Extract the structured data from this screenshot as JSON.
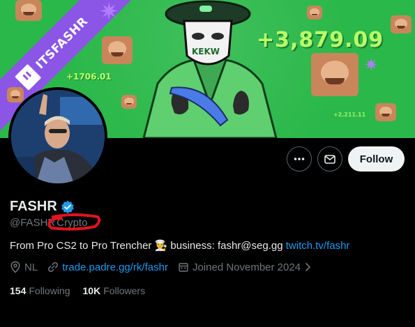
{
  "banner": {
    "ribbon_text": "ITSFASHR",
    "big_number": "+3,879.09",
    "small_number": "+1706.01",
    "tiny_number": "+2,211.11",
    "mask_text": "KEKW",
    "colors": {
      "background": "#2bb84a",
      "ribbon": "#8b55e6",
      "numbers": "#b9ff6a"
    }
  },
  "actions": {
    "more_icon": "ellipsis-icon",
    "message_icon": "envelope-icon",
    "follow_label": "Follow"
  },
  "profile": {
    "display_name": "FASHR",
    "verified_icon": "verified-badge-icon",
    "handle": "@FASHR",
    "handle_suffix": "Crypto",
    "bio_text": "From Pro CS2 to Pro Trencher 👨‍🍳 business: fashr@seg.gg ",
    "bio_link": "twitch.tv/fashr",
    "location": "NL",
    "website": "trade.padre.gg/rk/fashr",
    "joined": "Joined November 2024",
    "following_count": "154",
    "following_label": "Following",
    "followers_count": "10K",
    "followers_label": "Followers"
  },
  "colors": {
    "link": "#1d9bf0",
    "muted": "#71767b",
    "text": "#e7e9ea",
    "annotation": "#e0141e"
  }
}
